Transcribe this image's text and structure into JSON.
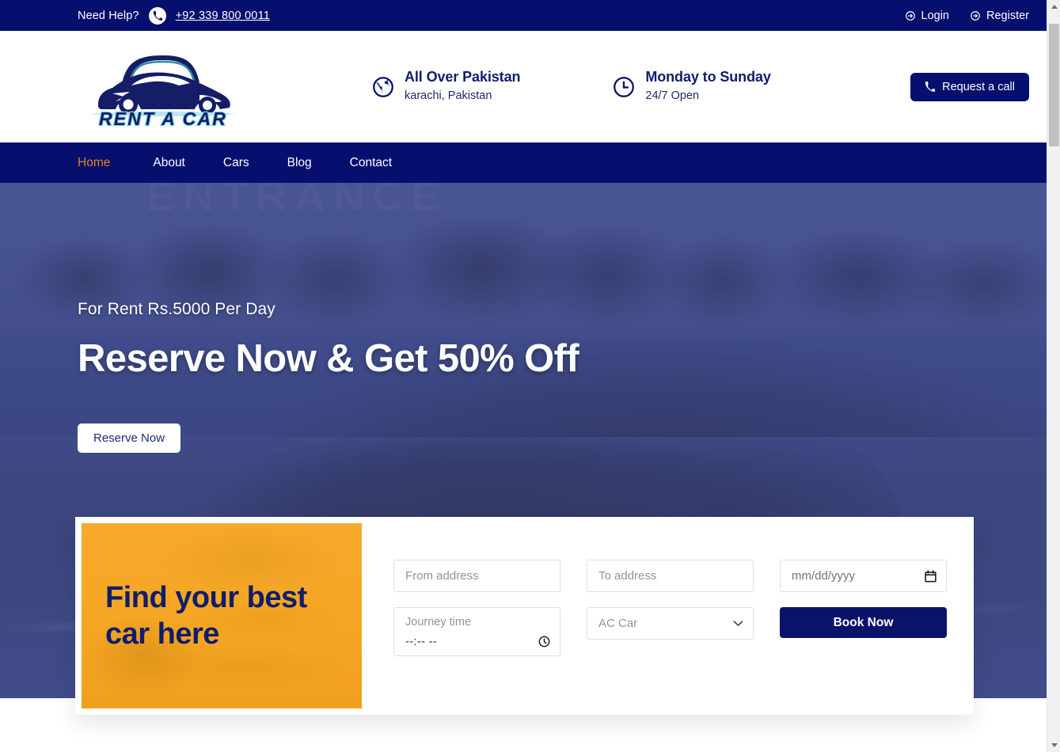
{
  "topbar": {
    "need_help_label": "Need Help?",
    "phone_icon": "phone-icon",
    "phone": "+92 339 800 0011",
    "login_label": "Login",
    "login_icon": "sign-in-icon",
    "register_label": "Register",
    "register_icon": "sign-in-icon"
  },
  "header": {
    "logo_text": "RENT A CAR",
    "logo_icon": "car-logo-icon",
    "location": {
      "icon": "globe-icon",
      "title": "All Over Pakistan",
      "subtitle": "karachi, Pakistan"
    },
    "hours": {
      "icon": "clock-icon",
      "title": "Monday to Sunday",
      "subtitle": "24/7 Open"
    },
    "request_call_label": "Request a call",
    "request_call_icon": "phone-handset-icon"
  },
  "nav": {
    "items": [
      {
        "label": "Home",
        "active": true
      },
      {
        "label": "About",
        "active": false
      },
      {
        "label": "Cars",
        "active": false
      },
      {
        "label": "Blog",
        "active": false
      },
      {
        "label": "Contact",
        "active": false
      }
    ]
  },
  "hero": {
    "background_signage": "ENTRANCE",
    "eyebrow": "For Rent Rs.5000 Per Day",
    "title": "Reserve Now & Get 50% Off",
    "cta_label": "Reserve Now"
  },
  "booking": {
    "promo_title": "Find your best car here",
    "from_placeholder": "From address",
    "from_value": "",
    "to_placeholder": "To address",
    "to_value": "",
    "date_placeholder": "mm/dd/yyyy",
    "date_icon": "calendar-icon",
    "time_label": "Journey time",
    "time_value": "--:-- --",
    "time_icon": "clock-icon",
    "car_type_selected": "AC Car",
    "car_type_icon": "chevron-down-icon",
    "book_label": "Book Now"
  },
  "colors": {
    "navy": "#060f6e",
    "orange_accent": "#e8821a",
    "promo_orange": "#f5a623",
    "white": "#ffffff"
  }
}
